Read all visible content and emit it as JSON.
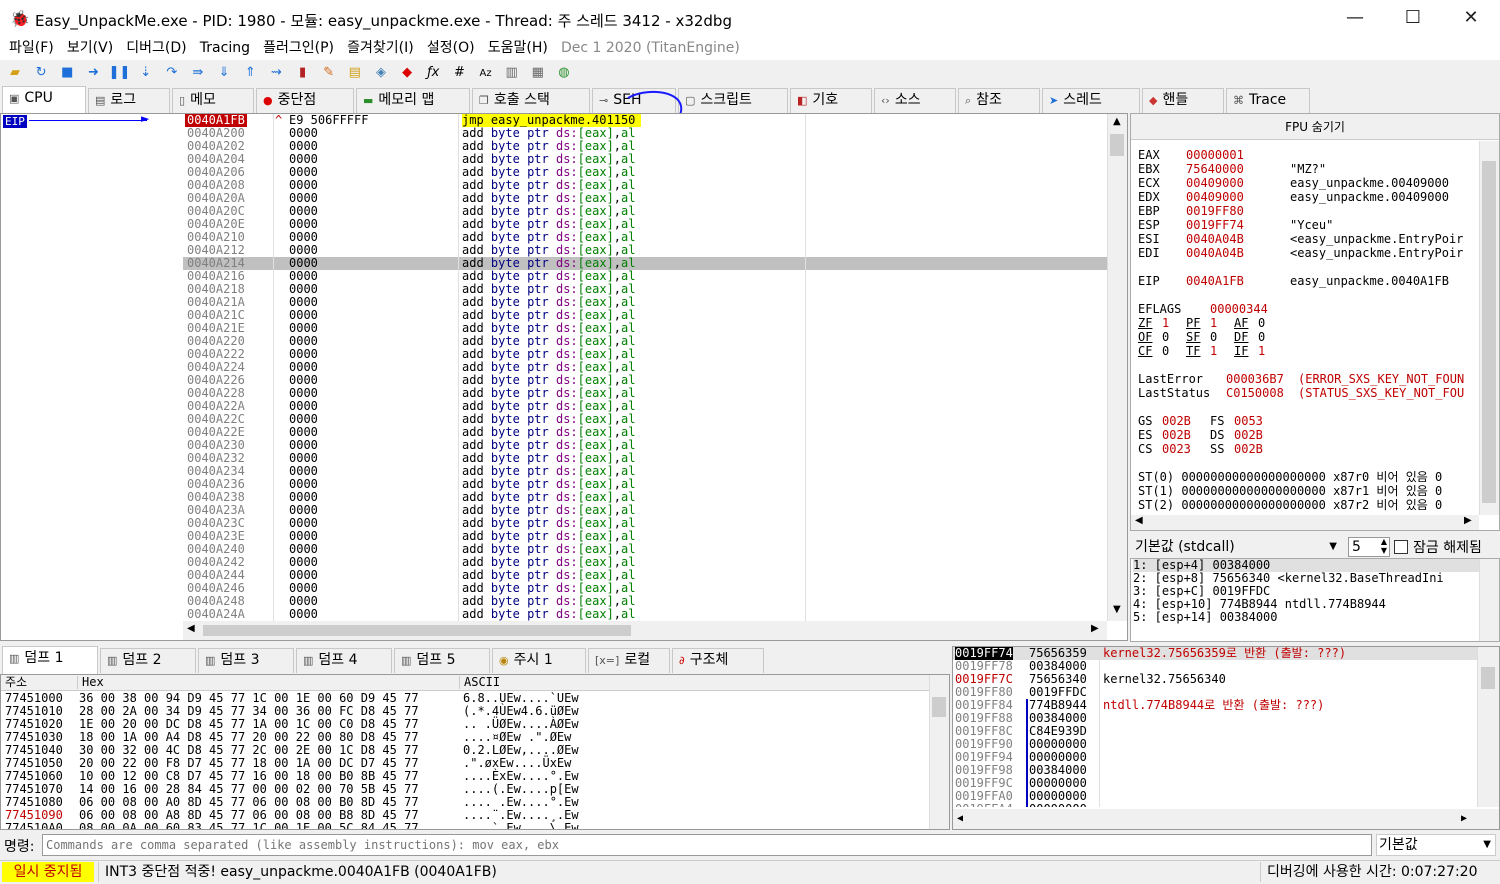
{
  "window": {
    "title": "Easy_UnpackMe.exe - PID: 1980 - 모듈: easy_unpackme.exe - Thread: 주 스레드 3412 - x32dbg",
    "min": "—",
    "max": "☐",
    "close": "✕"
  },
  "menu": [
    "파일(F)",
    "보기(V)",
    "디버그(D)",
    "Tracing",
    "플러그인(P)",
    "즐겨찾기(I)",
    "설정(O)",
    "도움말(H)"
  ],
  "menu_date": "Dec 1 2020 (TitanEngine)",
  "tabs": [
    "CPU",
    "로그",
    "메모",
    "중단점",
    "메모리 맵",
    "호출 스택",
    "SEH",
    "스크립트",
    "기호",
    "소스",
    "참조",
    "스레드",
    "핸들",
    "Trace"
  ],
  "eip_label": "EIP",
  "disasm": {
    "first": {
      "addr": "0040A1FB",
      "bytes": "E9 506FFFFF",
      "instr": "jmp easy_unpackme.401150",
      "arrow": "^"
    },
    "addrs": [
      "0040A200",
      "0040A202",
      "0040A204",
      "0040A206",
      "0040A208",
      "0040A20A",
      "0040A20C",
      "0040A20E",
      "0040A210",
      "0040A212",
      "0040A214",
      "0040A216",
      "0040A218",
      "0040A21A",
      "0040A21C",
      "0040A21E",
      "0040A220",
      "0040A222",
      "0040A224",
      "0040A226",
      "0040A228",
      "0040A22A",
      "0040A22C",
      "0040A22E",
      "0040A230",
      "0040A232",
      "0040A234",
      "0040A236",
      "0040A238",
      "0040A23A",
      "0040A23C",
      "0040A23E",
      "0040A240",
      "0040A242",
      "0040A244",
      "0040A246",
      "0040A248",
      "0040A24A"
    ],
    "bytes": "0000",
    "instr": {
      "add": "add",
      "byte": "byte",
      "ptr": "ptr",
      "ds": "ds:",
      "mem": "[eax]",
      "sep": ",",
      "reg": "al"
    }
  },
  "fpu": {
    "header": "FPU 숨기기",
    "regs": [
      {
        "n": "EAX",
        "v": "00000001",
        "c": ""
      },
      {
        "n": "EBX",
        "v": "75640000",
        "c": "\"MZ?\""
      },
      {
        "n": "ECX",
        "v": "00409000",
        "c": "easy_unpackme.00409000"
      },
      {
        "n": "EDX",
        "v": "00409000",
        "c": "easy_unpackme.00409000"
      },
      {
        "n": "EBP",
        "v": "0019FF80",
        "c": ""
      },
      {
        "n": "ESP",
        "v": "0019FF74",
        "c": "\"Yceu\""
      },
      {
        "n": "ESI",
        "v": "0040A04B",
        "c": "<easy_unpackme.EntryPoir"
      },
      {
        "n": "EDI",
        "v": "0040A04B",
        "c": "<easy_unpackme.EntryPoir"
      }
    ],
    "eip": {
      "n": "EIP",
      "v": "0040A1FB",
      "c": "easy_unpackme.0040A1FB"
    },
    "eflags": {
      "n": "EFLAGS",
      "v": "00000344"
    },
    "flags1": [
      "ZF",
      "1",
      "PF",
      "1",
      "AF",
      "0"
    ],
    "flags2": [
      "OF",
      "0",
      "SF",
      "0",
      "DF",
      "0"
    ],
    "flags3": [
      "CF",
      "0",
      "TF",
      "1",
      "IF",
      "1"
    ],
    "lasterror": {
      "n": "LastError",
      "v": "000036B7",
      "c": "(ERROR_SXS_KEY_NOT_FOUN"
    },
    "laststatus": {
      "n": "LastStatus",
      "v": "C0150008",
      "c": "(STATUS_SXS_KEY_NOT_FOU"
    },
    "seg1": [
      "GS",
      "002B",
      "FS",
      "0053"
    ],
    "seg2": [
      "ES",
      "002B",
      "DS",
      "002B"
    ],
    "seg3": [
      "CS",
      "0023",
      "SS",
      "002B"
    ],
    "st": [
      "ST(0) 00000000000000000000 x87r0 비어 있음 0",
      "ST(1) 00000000000000000000 x87r1 비어 있음 0",
      "ST(2) 00000000000000000000 x87r2 비어 있음 0"
    ]
  },
  "callconv": {
    "select": "기본값 (stdcall)",
    "count": "5",
    "unlock": "잠금 해제됨"
  },
  "callargs": [
    "1: [esp+4] 00384000",
    "2: [esp+8] 75656340 <kernel32.BaseThreadIni",
    "3: [esp+C] 0019FFDC",
    "4: [esp+10] 774B8944 ntdll.774B8944",
    "5: [esp+14] 00384000"
  ],
  "bottom_tabs": [
    "덤프 1",
    "덤프 2",
    "덤프 3",
    "덤프 4",
    "덤프 5",
    "주시 1",
    "로컬",
    "구조체"
  ],
  "dump": {
    "headers": [
      "주소",
      "Hex",
      "ASCII"
    ],
    "rows": [
      {
        "a": "77451000",
        "h": "36 00 38 00  94 D9 45 77  1C 00 1E 00  60 D9 45 77",
        "s": "6.8..ÙEw....`ÙEw"
      },
      {
        "a": "77451010",
        "h": "28 00 2A 00  34 D9 45 77  34 00 36 00  FC D8 45 77",
        "s": "(.*.4ÙEw4.6.üØEw"
      },
      {
        "a": "77451020",
        "h": "1E 00 20 00  DC D8 45 77  1A 00 1C 00  C0 D8 45 77",
        "s": ".. .ÜØEw....ÀØEw"
      },
      {
        "a": "77451030",
        "h": "18 00 1A 00  A4 D8 45 77  20 00 22 00  80 D8 45 77",
        "s": "....¤ØEw .\".ØEw"
      },
      {
        "a": "77451040",
        "h": "30 00 32 00  4C D8 45 77  2C 00 2E 00  1C D8 45 77",
        "s": "0.2.LØEw,....ØEw"
      },
      {
        "a": "77451050",
        "h": "20 00 22 00  F8 D7 45 77  18 00 1A 00  DC D7 45 77",
        "s": " .\".øxEw....ÜxEw"
      },
      {
        "a": "77451060",
        "h": "10 00 12 00  C8 D7 45 77  16 00 18 00  B0 8B 45 77",
        "s": "....ÈxEw....°.Ew"
      },
      {
        "a": "77451070",
        "h": "14 00 16 00  28 84 45 77  00 00 02 00  70 5B 45 77",
        "s": "....(.Ew....p[Ew"
      },
      {
        "a": "77451080",
        "h": "06 00 08 00  A0 8D 45 77  06 00 08 00  B0 8D 45 77",
        "s": ".... .Ew....°.Ew"
      },
      {
        "a": "77451090",
        "h": "06 00 08 00  A8 8D 45 77  06 00 08 00  B8 8D 45 77",
        "s": "....¨.Ew....¸.Ew"
      },
      {
        "a": "774510A0",
        "h": "08 00 0A 00  60 83 45 77  1C 00 1E 00  5C 84 45 77",
        "s": "....`.Ew....\\.Ew"
      }
    ]
  },
  "stack": {
    "rows": [
      {
        "a": "0019FF74",
        "v": "75656359",
        "c": "kernel32.75656359로 반환 (출발: ???)"
      },
      {
        "a": "0019FF78",
        "v": "00384000",
        "c": ""
      },
      {
        "a": "0019FF7C",
        "v": "75656340",
        "c": "kernel32.75656340"
      },
      {
        "a": "0019FF80",
        "v": "0019FFDC",
        "c": ""
      },
      {
        "a": "0019FF84",
        "v": "774B8944",
        "c": "ntdll.774B8944로 반환 (출발: ???)"
      },
      {
        "a": "0019FF88",
        "v": "00384000",
        "c": ""
      },
      {
        "a": "0019FF8C",
        "v": "C84E939D",
        "c": ""
      },
      {
        "a": "0019FF90",
        "v": "00000000",
        "c": ""
      },
      {
        "a": "0019FF94",
        "v": "00000000",
        "c": ""
      },
      {
        "a": "0019FF98",
        "v": "00384000",
        "c": ""
      },
      {
        "a": "0019FF9C",
        "v": "00000000",
        "c": ""
      },
      {
        "a": "0019FFA0",
        "v": "00000000",
        "c": ""
      },
      {
        "a": "0019FFA4",
        "v": "00000000",
        "c": ""
      }
    ]
  },
  "command": {
    "label": "명령:",
    "placeholder": "Commands are comma separated (like assembly instructions): mov eax, ebx",
    "right": "기본값"
  },
  "status": {
    "state": "일시 중지됨",
    "msg": "INT3 중단점 적중! easy_unpackme.0040A1FB (0040A1FB)",
    "time": "디버깅에 사용한 시간: 0:07:27:20"
  },
  "colors": {
    "accent": "#0000ff",
    "paused": "#ffff00",
    "red": "#c00000",
    "highlight": "#ffff00"
  }
}
